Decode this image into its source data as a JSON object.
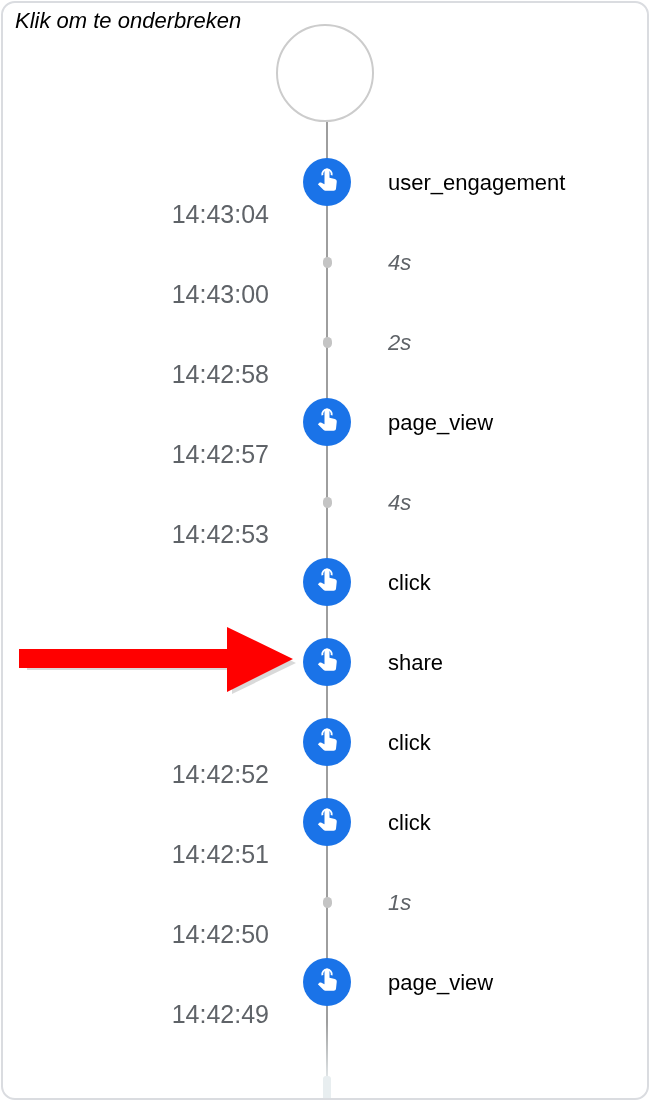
{
  "header": {
    "hint": "Klik om te onderbreken"
  },
  "timeline": [
    {
      "kind": "event",
      "label": "user_engagement",
      "time": "14:43:04",
      "marked": false
    },
    {
      "kind": "gap",
      "label": "4s",
      "time": "14:43:00"
    },
    {
      "kind": "gap",
      "label": "2s",
      "time": "14:42:58"
    },
    {
      "kind": "event",
      "label": "page_view",
      "time": "14:42:57",
      "marked": false
    },
    {
      "kind": "gap",
      "label": "4s",
      "time": "14:42:53"
    },
    {
      "kind": "event",
      "label": "click",
      "marked": false
    },
    {
      "kind": "event",
      "label": "share",
      "marked": true
    },
    {
      "kind": "event",
      "label": "click",
      "time": "14:42:52",
      "marked": false
    },
    {
      "kind": "event",
      "label": "click",
      "time": "14:42:51",
      "marked": false
    },
    {
      "kind": "gap",
      "label": "1s",
      "time": "14:42:50"
    },
    {
      "kind": "event",
      "label": "page_view",
      "time": "14:42:49",
      "marked": false
    }
  ]
}
